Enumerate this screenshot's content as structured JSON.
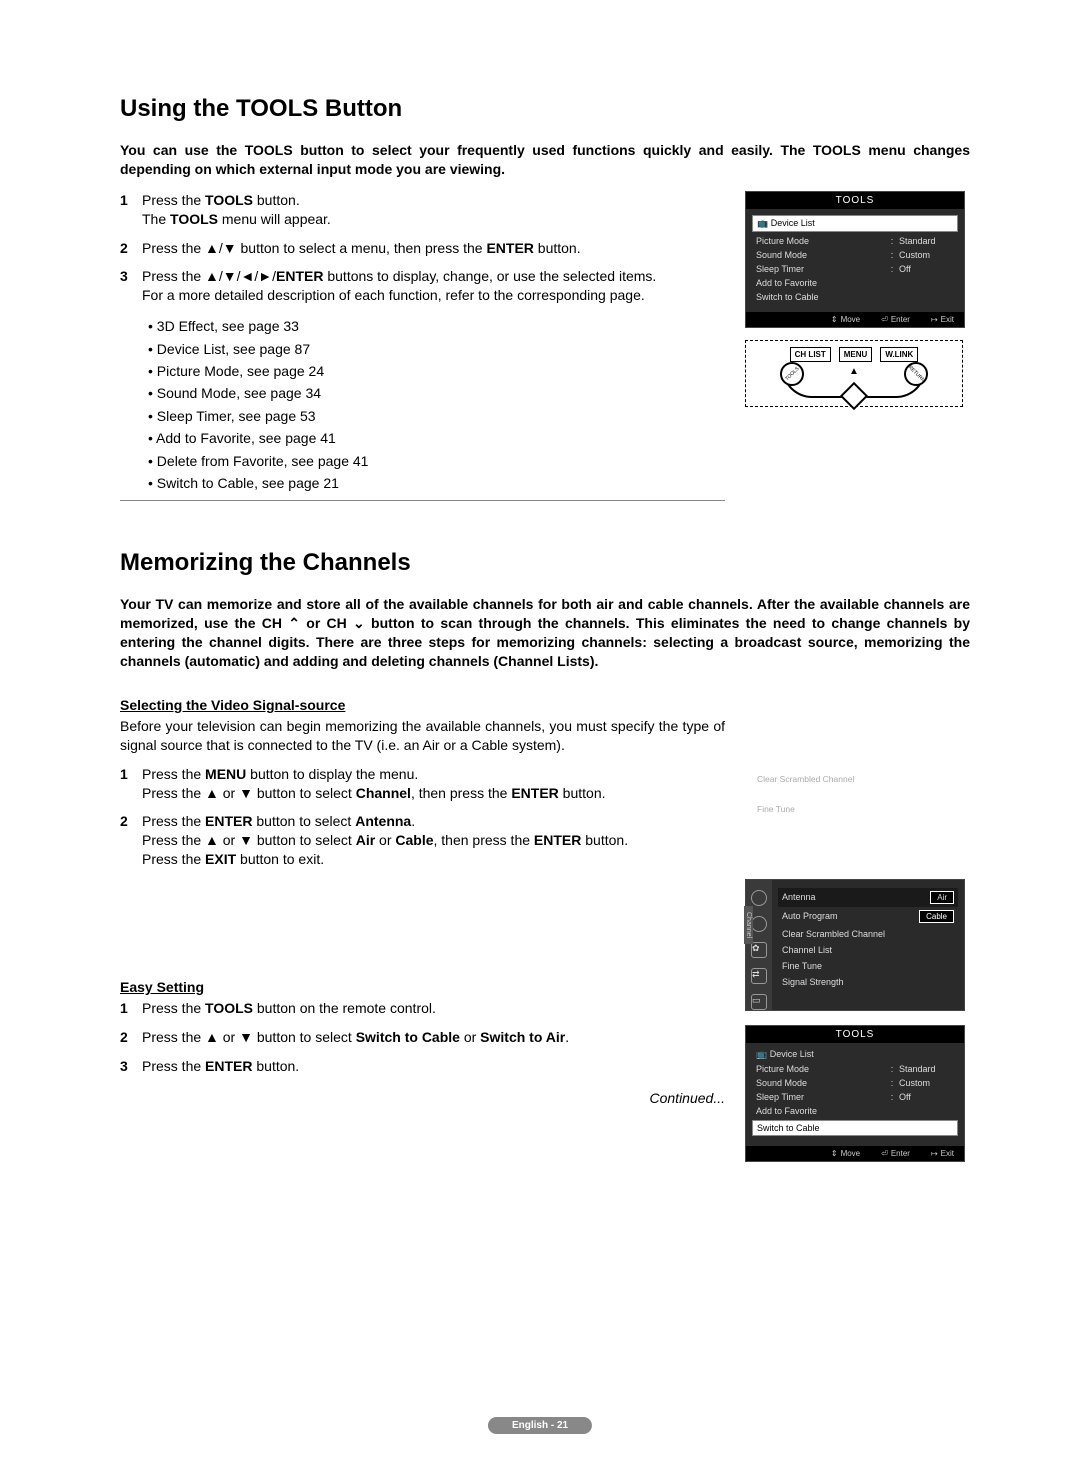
{
  "section1": {
    "heading": "Using the TOOLS Button",
    "intro": "You can use the TOOLS button to select your frequently used functions quickly and easily. The TOOLS menu changes depending on which external input mode you are viewing.",
    "steps": [
      {
        "n": "1",
        "body": "Press the <b>TOOLS</b> button.<br>The <b>TOOLS</b> menu will appear."
      },
      {
        "n": "2",
        "body": "Press the ▲/▼ button to select a menu, then press the <b>ENTER</b> button."
      },
      {
        "n": "3",
        "body": "Press the ▲/▼/◄/►/<b>ENTER</b> buttons to display, change, or use the selected items.<br>For a more detailed description of each function, refer to the corresponding page."
      }
    ],
    "bullets": [
      "3D Effect, see page 33",
      "Device List, see page 87",
      "Picture Mode, see page 24",
      "Sound Mode, see page 34",
      "Sleep Timer, see page 53",
      "Add to Favorite, see page 41",
      "Delete from Favorite, see page 41",
      "Switch to Cable, see page 21"
    ]
  },
  "tools_panel_1": {
    "title": "TOOLS",
    "highlight": "Device List",
    "rows": [
      {
        "label": "Picture Mode",
        "val": "Standard"
      },
      {
        "label": "Sound Mode",
        "val": "Custom"
      },
      {
        "label": "Sleep Timer",
        "val": "Off"
      },
      {
        "label": "Add to Favorite",
        "val": ""
      },
      {
        "label": "Switch to Cable",
        "val": ""
      }
    ],
    "footer": {
      "move": "Move",
      "enter": "Enter",
      "exit": "Exit"
    }
  },
  "remote": {
    "btns": [
      "CH LIST",
      "MENU",
      "W.LINK"
    ],
    "left": "TOOLS",
    "right": "RETURN"
  },
  "section2": {
    "heading": "Memorizing the Channels",
    "intro": "Your TV can memorize and store all of the available channels for both air and cable channels. After the available channels are memorized, use the CH ⌃ or CH ⌄ button to scan through the channels. This eliminates the need to change channels by entering the channel digits. There are three steps for memorizing channels: selecting a broadcast source, memorizing the channels (automatic) and adding and deleting channels (Channel Lists).",
    "sub1_head": "Selecting the Video Signal-source",
    "sub1_intro": "Before your television can begin memorizing the available channels, you must specify the type of signal source that is connected to the TV (i.e. an Air or a Cable system).",
    "sub1_steps": [
      {
        "n": "1",
        "body": "Press the <b>MENU</b> button to display the menu.<br>Press the ▲ or ▼ button to select <b>Channel</b>, then press the <b>ENTER</b> button."
      },
      {
        "n": "2",
        "body": "Press the <b>ENTER</b> button to select <b>Antenna</b>.<br>Press the ▲ or ▼ button to select <b>Air</b> or <b>Cable</b>, then press the <b>ENTER</b> button.<br>Press the <b>EXIT</b> button to exit."
      }
    ],
    "sub2_head": "Easy Setting",
    "sub2_steps": [
      {
        "n": "1",
        "body": "Press the <b>TOOLS</b> button on the remote control."
      },
      {
        "n": "2",
        "body": "Press the ▲ or ▼ button to select <b>Switch to Cable</b> or <b>Switch to Air</b>."
      },
      {
        "n": "3",
        "body": "Press the <b>ENTER</b> button."
      }
    ],
    "continued": "Continued..."
  },
  "mini_menu": {
    "a": "Clear Scrambled Channel",
    "b": "Fine Tune"
  },
  "channel_panel": {
    "side": "Channel",
    "rows": [
      {
        "label": "Antenna",
        "val": "Air",
        "sel": true,
        "hi": true
      },
      {
        "label": "Auto Program",
        "val": "Cable",
        "cable": true
      },
      {
        "label": "Clear Scrambled Channel"
      },
      {
        "label": "Channel List"
      },
      {
        "label": "Fine Tune"
      },
      {
        "label": "Signal Strength"
      }
    ]
  },
  "tools_panel_2": {
    "title": "TOOLS",
    "top": "Device List",
    "rows": [
      {
        "label": "Picture Mode",
        "val": "Standard"
      },
      {
        "label": "Sound Mode",
        "val": "Custom"
      },
      {
        "label": "Sleep Timer",
        "val": "Off"
      },
      {
        "label": "Add to Favorite",
        "val": ""
      }
    ],
    "highlight": "Switch to Cable",
    "footer": {
      "move": "Move",
      "enter": "Enter",
      "exit": "Exit"
    }
  },
  "pagebadge": "English - 21"
}
